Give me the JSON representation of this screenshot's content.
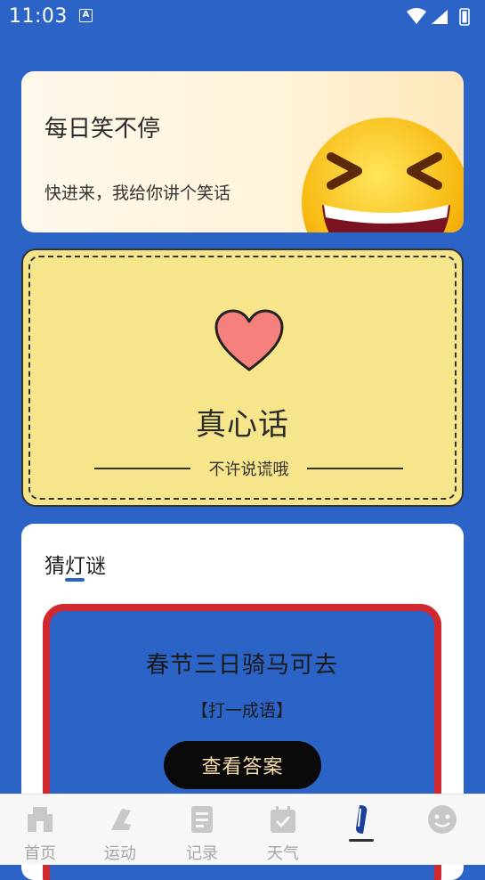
{
  "status_bar": {
    "time": "11:03",
    "notification_icon": "A"
  },
  "joke_card": {
    "title": "每日笑不停",
    "subtitle": "快进来，我给你讲个笑话",
    "icon": "laughing-emoji-icon"
  },
  "truth_card": {
    "title": "真心话",
    "subtitle": "不许说谎哦",
    "icon": "heart-icon",
    "background": "#f7e58b"
  },
  "riddle_card": {
    "section_title": "猜灯谜",
    "question": "春节三日骑马可去",
    "hint": "【打一成语】",
    "answer_button": "查看答案",
    "border_color": "#d0282e"
  },
  "bottom_nav": {
    "items": [
      {
        "label": "首页",
        "icon": "home-icon"
      },
      {
        "label": "运动",
        "icon": "sneaker-icon"
      },
      {
        "label": "记录",
        "icon": "notes-icon"
      },
      {
        "label": "天气",
        "icon": "calendar-check-icon"
      },
      {
        "label": "",
        "icon": "brush-icon",
        "active": true
      },
      {
        "label": "",
        "icon": "smiley-face-icon"
      }
    ]
  },
  "colors": {
    "background": "#2b64c6",
    "accent": "#2b64c6"
  }
}
